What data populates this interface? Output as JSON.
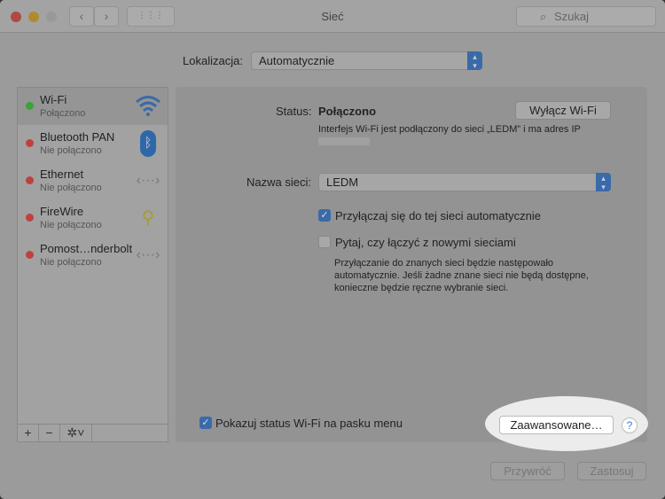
{
  "window": {
    "title": "Sieć",
    "search_placeholder": "Szukaj"
  },
  "location": {
    "label": "Lokalizacja:",
    "value": "Automatycznie"
  },
  "services": [
    {
      "name": "Wi-Fi",
      "status": "Połączono",
      "status_color": "#3aa33a",
      "icon": "wifi-icon"
    },
    {
      "name": "Bluetooth PAN",
      "status": "Nie połączono",
      "status_color": "#c04040",
      "icon": "bluetooth-icon"
    },
    {
      "name": "Ethernet",
      "status": "Nie połączono",
      "status_color": "#c04040",
      "icon": "ethernet-icon"
    },
    {
      "name": "FireWire",
      "status": "Nie połączono",
      "status_color": "#c04040",
      "icon": "firewire-icon"
    },
    {
      "name": "Pomost…nderbolt",
      "status": "Nie połączono",
      "status_color": "#c04040",
      "icon": "bridge-icon"
    }
  ],
  "detail": {
    "status_label": "Status:",
    "status_value": "Połączono",
    "turn_off": "Wyłącz Wi-Fi",
    "status_desc": "Interfejs Wi-Fi jest podłączony do sieci „LEDM” i ma adres IP",
    "network_label": "Nazwa sieci:",
    "network_value": "LEDM",
    "auto_join": "Przyłączaj się do tej sieci automatycznie",
    "auto_join_checked": true,
    "ask_join": "Pytaj, czy łączyć z nowymi sieciami",
    "ask_join_checked": false,
    "ask_desc_1": "Przyłączanie do znanych sieci będzie następowało",
    "ask_desc_2": "automatycznie. Jeśli żadne znane sieci nie będą dostępne,",
    "ask_desc_3": "konieczne będzie ręczne wybranie sieci.",
    "show_status": "Pokazuj status Wi-Fi na pasku menu",
    "show_status_checked": true,
    "advanced": "Zaawansowane…",
    "help": "?"
  },
  "footer": {
    "revert": "Przywróć",
    "apply": "Zastosuj"
  }
}
